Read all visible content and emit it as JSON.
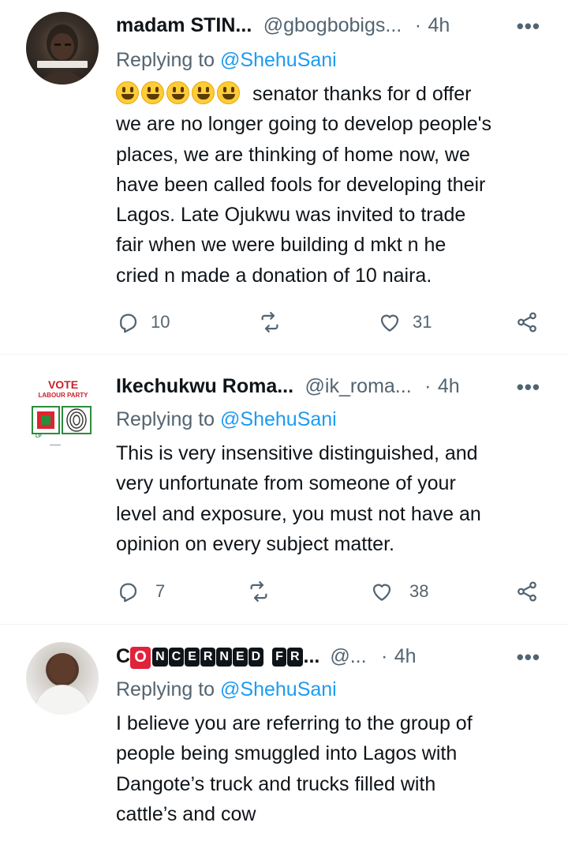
{
  "tweets": [
    {
      "name": "madam STIN...",
      "handle": "@gbogbobigs...",
      "separator": "·",
      "time": "4h",
      "more": "•••",
      "replying_prefix": "Replying to ",
      "replying_to": "@ShehuSani",
      "emoji_count": 5,
      "lines": [
        "senator thanks for d offer",
        "we are no longer going to develop people's",
        "places, we are thinking of home now, we",
        "have been called fools for developing their",
        "Lagos. Late Ojukwu was invited to trade",
        "fair when we were building d mkt n he",
        "cried n made a donation of 10 naira."
      ],
      "replies": "10",
      "retweets": "",
      "likes": "31"
    },
    {
      "name": "Ikechukwu Roma...",
      "handle": "@ik_roma...",
      "separator": "·",
      "time": "4h",
      "more": "•••",
      "replying_prefix": "Replying to ",
      "replying_to": "@ShehuSani",
      "avatar_text": {
        "vote": "VOTE",
        "party": "LABOUR PARTY",
        "lp": "LP"
      },
      "lines": [
        "This is very insensitive distinguished, and",
        "very unfortunate from someone of your",
        "level and exposure, you must not have an",
        "opinion on every subject matter."
      ],
      "replies": "7",
      "retweets": "",
      "likes": "38"
    },
    {
      "name_parts": {
        "c": "C",
        "o": "O",
        "boxes": [
          "N",
          "C",
          "E",
          "R",
          "N",
          "E",
          "D"
        ],
        "boxes2": [
          "F",
          "R"
        ],
        "ellipsis": "..."
      },
      "handle": "@...",
      "separator": "·",
      "time": "4h",
      "more": "•••",
      "replying_prefix": "Replying to ",
      "replying_to": "@ShehuSani",
      "lines": [
        "I believe you are referring to the group of",
        "people being smuggled into Lagos with",
        "Dangote’s truck and trucks filled with",
        "cattle’s and cow"
      ]
    }
  ],
  "icons": {
    "reply": "reply-icon",
    "retweet": "retweet-icon",
    "like": "heart-icon",
    "share": "share-icon",
    "more": "more-icon"
  },
  "colors": {
    "text": "#0f1419",
    "secondary": "#536471",
    "link": "#1d9bf0",
    "divider": "#eff3f4"
  }
}
